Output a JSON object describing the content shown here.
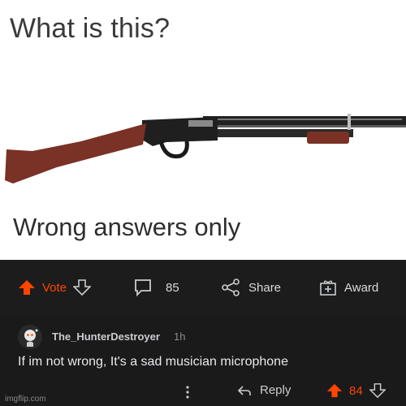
{
  "meme": {
    "title": "What is this?",
    "subtitle": "Wrong answers only",
    "stock_color": "#7a3126",
    "metal_color": "#1f1f1f"
  },
  "action_bar": {
    "vote_label": "Vote",
    "comments_count": "85",
    "share_label": "Share",
    "award_label": "Award",
    "accent_color": "#ff4500"
  },
  "comment": {
    "username": "The_HunterDestroyer",
    "time": "1h",
    "text": "If im not wrong, It's a sad musician microphone",
    "reply_label": "Reply",
    "score": "84"
  },
  "watermark": "imgflip.com"
}
